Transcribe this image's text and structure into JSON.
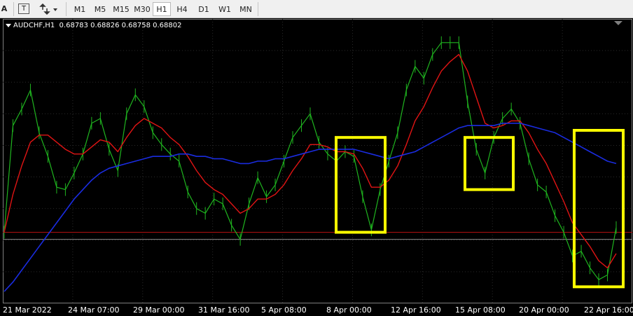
{
  "toolbar": {
    "text_tool": "A",
    "text_label_tool": "T",
    "timeframes": [
      "M1",
      "M5",
      "M15",
      "M30",
      "H1",
      "H4",
      "D1",
      "W1",
      "MN"
    ],
    "active_timeframe": "H1"
  },
  "chart_header": {
    "symbol": "AUDCHF,H1",
    "ohlc": "0.68783 0.68826 0.68758 0.68802"
  },
  "time_axis": {
    "labels": [
      "21 Mar 2022",
      "24 Mar 07:00",
      "29 Mar 00:00",
      "31 Mar 16:00",
      "5 Apr 08:00",
      "8 Apr 00:00",
      "12 Apr 16:00",
      "15 Apr 08:00",
      "20 Apr 00:00",
      "22 Apr 16:00"
    ]
  },
  "colors": {
    "background": "#000000",
    "price": "#1fb51f",
    "ma_fast": "#e01414",
    "ma_slow": "#1a2ce0",
    "highlight": "#ffff00",
    "level_red": "#b01010",
    "level_grey": "#8c8c8c"
  },
  "chart_data": {
    "type": "line",
    "title": "AUDCHF,H1",
    "x": [
      "21 Mar 2022",
      "24 Mar 07:00",
      "29 Mar 00:00",
      "31 Mar 16:00",
      "5 Apr 08:00",
      "8 Apr 00:00",
      "12 Apr 16:00",
      "15 Apr 08:00",
      "20 Apr 00:00",
      "22 Apr 16:00"
    ],
    "series": [
      {
        "values": [
          0.68,
          0.6845,
          0.6852,
          0.686,
          0.6842,
          0.6832,
          0.6819,
          0.6818,
          0.6825,
          0.6833,
          0.6846,
          0.6848,
          0.6835,
          0.6826,
          0.685,
          0.6858,
          0.6853,
          0.6842,
          0.6837,
          0.6833,
          0.683,
          0.6817,
          0.681,
          0.6808,
          0.6814,
          0.6812,
          0.6803,
          0.6797,
          0.6812,
          0.6823,
          0.6815,
          0.682,
          0.683,
          0.684,
          0.6845,
          0.685,
          0.6838,
          0.6833,
          0.683,
          0.6834,
          0.6832,
          0.6815,
          0.6801,
          0.6818,
          0.683,
          0.6842,
          0.686,
          0.687,
          0.6865,
          0.6875,
          0.688,
          0.688,
          0.688,
          0.6855,
          0.6835,
          0.6825,
          0.684,
          0.6848,
          0.6852,
          0.6846,
          0.6831,
          0.682,
          0.6817,
          0.6807,
          0.68,
          0.679,
          0.6792,
          0.6785,
          0.678,
          0.6782,
          0.6802
        ]
      },
      {
        "values": [
          0.68,
          0.6816,
          0.6828,
          0.6838,
          0.6841,
          0.6841,
          0.6838,
          0.6835,
          0.6833,
          0.6833,
          0.6836,
          0.6839,
          0.6838,
          0.6834,
          0.684,
          0.6845,
          0.6848,
          0.6846,
          0.6844,
          0.684,
          0.6837,
          0.6832,
          0.6826,
          0.6821,
          0.6818,
          0.6816,
          0.6812,
          0.6808,
          0.681,
          0.6814,
          0.6814,
          0.6816,
          0.682,
          0.6826,
          0.6831,
          0.6837,
          0.6837,
          0.6836,
          0.6834,
          0.6834,
          0.6833,
          0.6827,
          0.6819,
          0.6819,
          0.6822,
          0.6828,
          0.6837,
          0.6847,
          0.6853,
          0.6861,
          0.6868,
          0.6872,
          0.6875,
          0.6868,
          0.6857,
          0.6846,
          0.6844,
          0.6845,
          0.6847,
          0.6847,
          0.6842,
          0.6835,
          0.6829,
          0.6821,
          0.6813,
          0.6804,
          0.6799,
          0.6794,
          0.6788,
          0.6785,
          0.6791
        ]
      },
      {
        "values": [
          0.6775,
          0.6779,
          0.6784,
          0.6789,
          0.6794,
          0.6799,
          0.6804,
          0.6809,
          0.6814,
          0.6818,
          0.6822,
          0.6825,
          0.6827,
          0.6828,
          0.6829,
          0.683,
          0.6831,
          0.6832,
          0.6832,
          0.6832,
          0.6833,
          0.6833,
          0.6832,
          0.6832,
          0.6831,
          0.6831,
          0.683,
          0.6829,
          0.6829,
          0.683,
          0.683,
          0.6831,
          0.6831,
          0.6832,
          0.6833,
          0.6834,
          0.6835,
          0.6835,
          0.6835,
          0.6835,
          0.6835,
          0.6834,
          0.6833,
          0.6832,
          0.6831,
          0.6832,
          0.6833,
          0.6834,
          0.6836,
          0.6838,
          0.684,
          0.6842,
          0.6844,
          0.6845,
          0.6845,
          0.6845,
          0.6845,
          0.6846,
          0.6846,
          0.6846,
          0.6845,
          0.6844,
          0.6843,
          0.6842,
          0.684,
          0.6838,
          0.6836,
          0.6834,
          0.6832,
          0.683,
          0.6829
        ]
      }
    ],
    "levels": [
      0.68,
      0.6797
    ],
    "ylim": [
      0.677,
      0.689
    ],
    "highlight_boxes": [
      {
        "x_from": "8 Apr 00:00",
        "x_to": "12 Apr 16:00",
        "y_range": [
          0.68,
          0.684
        ]
      },
      {
        "x_from": "15 Apr 08:00",
        "x_to": "20 Apr 00:00",
        "y_range": [
          0.6818,
          0.684
        ]
      },
      {
        "x_from": "22 Apr 16:00",
        "x_to": "22 Apr 16:00",
        "y_range": [
          0.6777,
          0.6843
        ]
      }
    ],
    "grid": true
  }
}
